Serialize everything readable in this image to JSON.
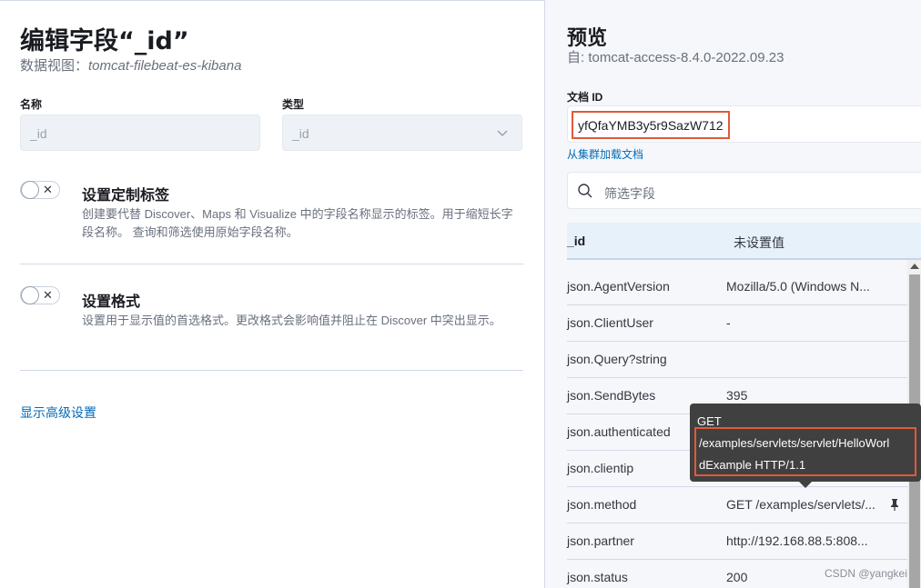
{
  "left": {
    "title": "编辑字段“_id”",
    "subtitle_prefix": "数据视图：",
    "subtitle_name": "tomcat-filebeat-es-kibana",
    "name_label": "名称",
    "name_placeholder": "_id",
    "type_label": "类型",
    "type_value": "_id",
    "custom_label": {
      "toggle_symbol": "✕",
      "title": "设置定制标签",
      "desc": "创建要代替 Discover、Maps 和 Visualize 中的字段名称显示的标签。用于缩短长字段名称。 查询和筛选使用原始字段名称。"
    },
    "format": {
      "toggle_symbol": "✕",
      "title": "设置格式",
      "desc": "设置用于显示值的首选格式。更改格式会影响值并阻止在 Discover 中突出显示。"
    },
    "advanced_link": "显示高级设置"
  },
  "preview": {
    "title": "预览",
    "from": "自: tomcat-access-8.4.0-2022.09.23",
    "doc_id_label": "文档 ID",
    "doc_id_value": "yfQfaYMB3y5r9SazW712",
    "load_link": "从集群加载文档",
    "filter_placeholder": "筛选字段",
    "highlight": {
      "key": "_id",
      "value": "未设置值"
    },
    "rows": [
      {
        "key": "json.AgentVersion",
        "value": "Mozilla/5.0 (Windows N..."
      },
      {
        "key": "json.ClientUser",
        "value": "-"
      },
      {
        "key": "json.Query?string",
        "value": ""
      },
      {
        "key": "json.SendBytes",
        "value": "395"
      },
      {
        "key": "json.authenticated",
        "value": ""
      },
      {
        "key": "json.clientip",
        "value": ""
      },
      {
        "key": "json.method",
        "value": "GET /examples/servlets/..."
      },
      {
        "key": "json.partner",
        "value": "http://192.168.88.5:808..."
      },
      {
        "key": "json.status",
        "value": "200"
      }
    ],
    "tooltip": {
      "line1": "GET",
      "line2": "/examples/servlets/servlet/HelloWorl",
      "line3": "dExample HTTP/1.1"
    }
  },
  "watermark": "CSDN @yangkei",
  "colors": {
    "accent": "#006bb8",
    "highlight_box": "#e05a3b",
    "tooltip_bg": "#404040"
  }
}
